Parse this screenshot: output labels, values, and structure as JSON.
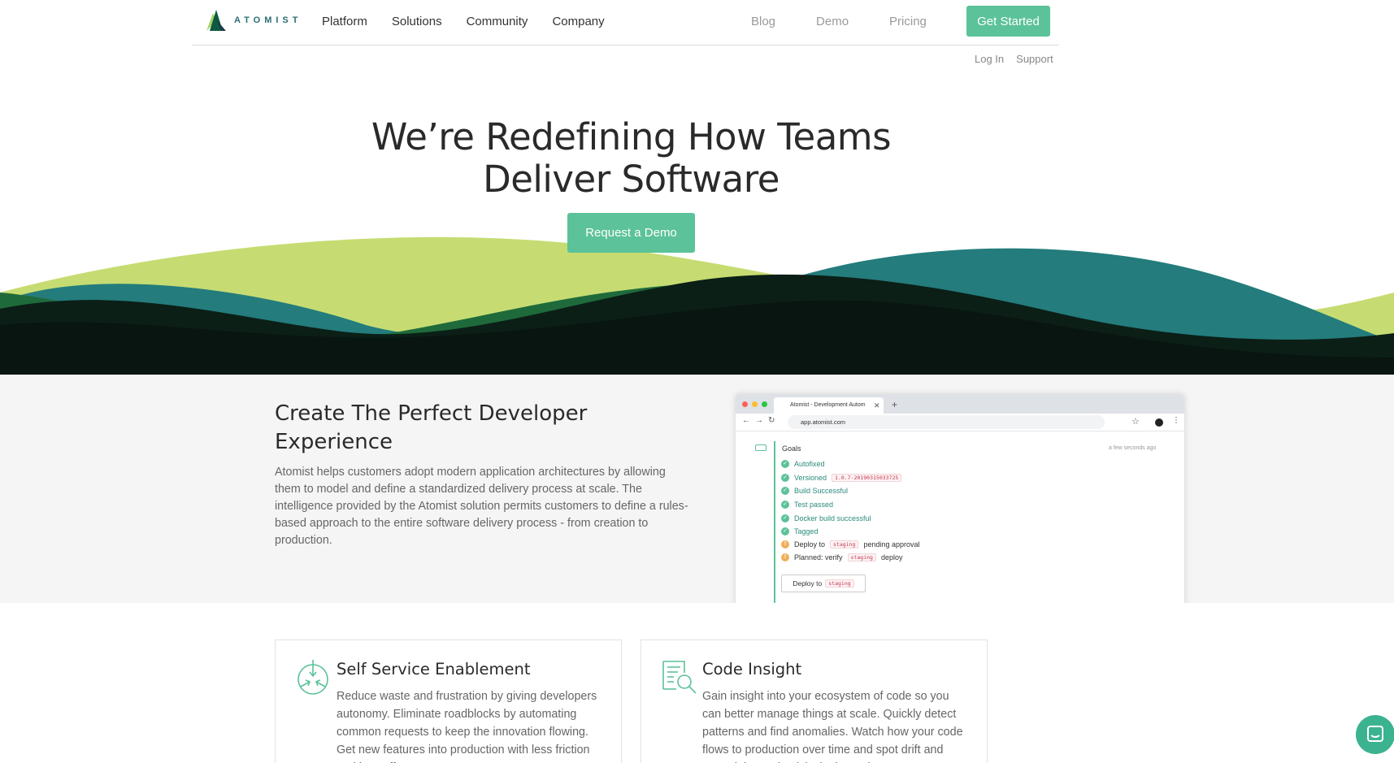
{
  "header": {
    "logo_text": "ATOMIST",
    "nav_main": [
      "Platform",
      "Solutions",
      "Community",
      "Company"
    ],
    "nav_right": [
      "Blog",
      "Demo",
      "Pricing"
    ],
    "cta_label": "Get Started",
    "subnav": [
      "Log In",
      "Support"
    ]
  },
  "hero": {
    "title_line1": "We’re Redefining How Teams",
    "title_line2": "Deliver Software",
    "button_label": "Request a Demo"
  },
  "section2": {
    "title": "Create The Perfect Developer Experience",
    "body": "Atomist helps customers adopt modern application architectures by allowing them to model and define a standardized delivery process at scale. The intelligence provided by the Atomist solution permits customers to define a rules-based approach to the entire software delivery process - from creation to production."
  },
  "mockup": {
    "tab_title": "Atomist - Development Autom",
    "url": "app.atomist.com",
    "goals_title": "Goals",
    "time": "a few seconds ago",
    "goals": [
      {
        "label": "Autofixed",
        "status": "success"
      },
      {
        "label": "Versioned",
        "code": "1.0.7-20190315033725",
        "status": "success"
      },
      {
        "label": "Build Successful",
        "status": "success"
      },
      {
        "label": "Test passed",
        "status": "success"
      },
      {
        "label": "Docker build successful",
        "status": "success"
      },
      {
        "label": "Tagged",
        "status": "success"
      }
    ],
    "pending1_prefix": "Deploy to",
    "pending1_code": "staging",
    "pending1_suffix": "pending approval",
    "pending2_prefix": "Planned: verify",
    "pending2_code": "staging",
    "pending2_suffix": "deploy",
    "deploy_button_prefix": "Deploy to",
    "deploy_button_code": "staging"
  },
  "cards": [
    {
      "title": "Self Service Enablement",
      "body": "Reduce waste and frustration by giving developers autonomy. Eliminate roadblocks by automating common requests to keep the innovation flowing. Get new features into production with less friction and less effort.",
      "icon": "target-arrows-icon"
    },
    {
      "title": "Code Insight",
      "body": "Gain insight into your ecosystem of code so you can better manage things at scale. Quickly detect patterns and find anomalies. Watch how your code flows to production over time and spot drift and potential security risks in the code.",
      "icon": "document-search-icon"
    }
  ],
  "colors": {
    "accent": "#5cc299",
    "wave_lime": "#c6dc72",
    "wave_teal": "#247c7c",
    "wave_green": "#1f6a3b",
    "wave_dark": "#091411"
  }
}
